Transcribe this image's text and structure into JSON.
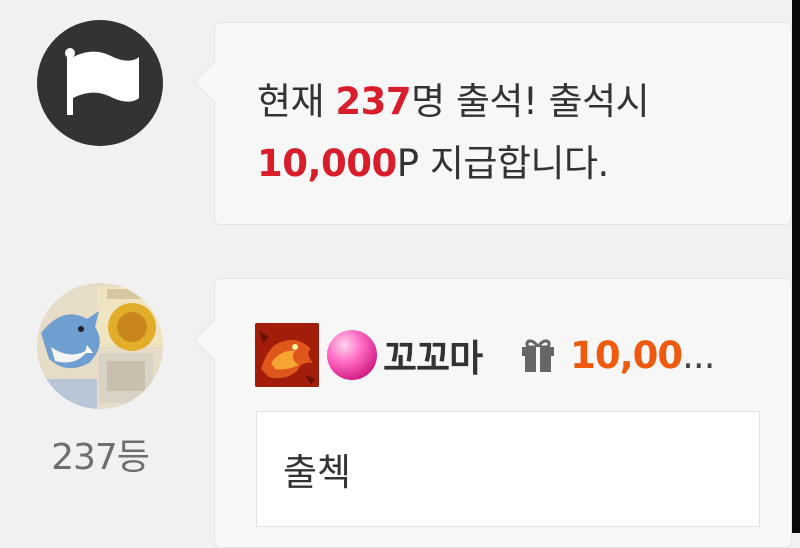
{
  "notice": {
    "part1": "현재 ",
    "count": "237",
    "part2": "명 출석! 출석시",
    "reward": "10,000",
    "part3": "P 지급합니다.",
    "icon": "flag-icon"
  },
  "entry": {
    "rank": "237등",
    "nickname": "꼬꼬마",
    "gift_points": "10,00",
    "truncation": "...",
    "comment": "출첵",
    "icons": [
      "level-badge-icon",
      "pink-orb-icon",
      "gift-icon"
    ]
  },
  "colors": {
    "highlight_red": "#d81e2a",
    "points_orange": "#f05a0f",
    "bubble_bg": "#f7f7f7",
    "avatar_dark": "#333333"
  }
}
